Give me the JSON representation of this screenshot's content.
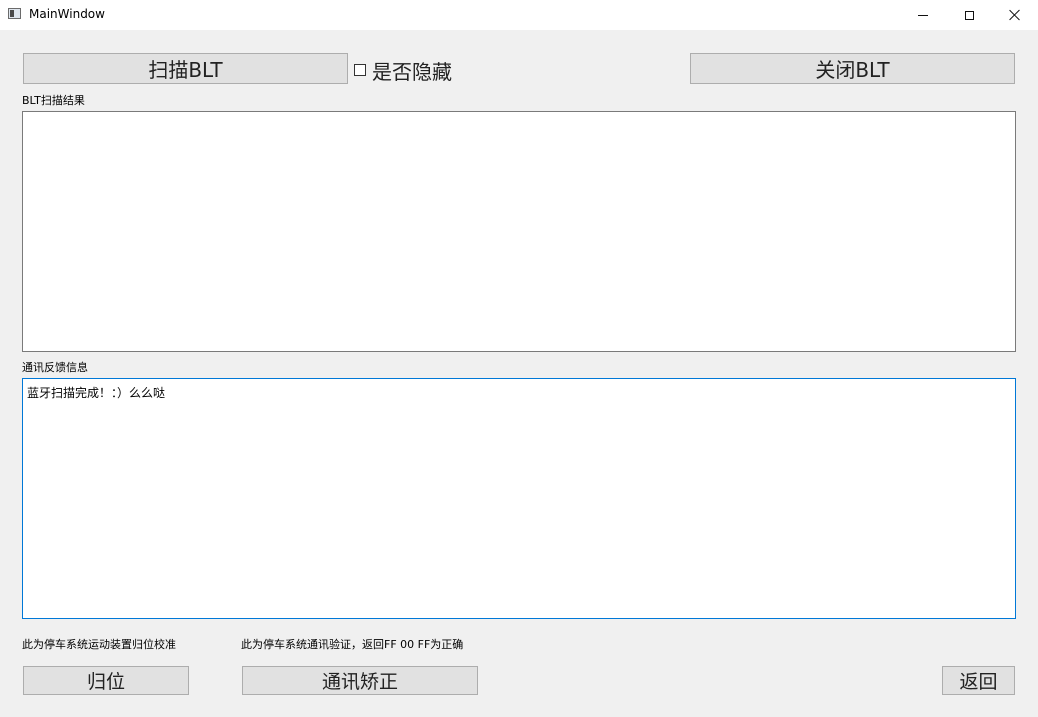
{
  "window": {
    "title": "MainWindow"
  },
  "toolbar": {
    "scan_label": "扫描BLT",
    "hide_checkbox_label": "是否隐藏",
    "hide_checked": false,
    "close_label": "关闭BLT"
  },
  "scan_results": {
    "label": "BLT扫描结果",
    "content": ""
  },
  "feedback": {
    "label": "通讯反馈信息",
    "content": "蓝牙扫描完成！：）么么哒"
  },
  "bottom": {
    "reset_hint": "此为停车系统运动装置归位校准",
    "comm_hint": "此为停车系统通讯验证，返回FF 00 FF为正确",
    "reset_label": "归位",
    "comm_label": "通讯矫正",
    "back_label": "返回"
  },
  "icons": {
    "app": "app-window-icon",
    "minimize": "minimize-icon",
    "maximize": "maximize-icon",
    "close": "close-icon"
  },
  "colors": {
    "focus_border": "#0078d7",
    "button_bg": "#e1e1e1",
    "window_bg": "#f0f0f0"
  }
}
